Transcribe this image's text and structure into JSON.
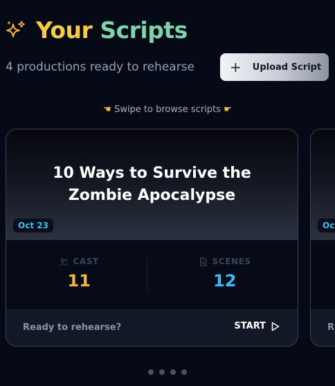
{
  "header": {
    "icon": "sparkles-icon",
    "title_part1": "Your",
    "title_part2": "Scripts",
    "subtitle": "4 productions ready to rehearse",
    "upload_icon": "plus-icon",
    "upload_label": "Upload Script"
  },
  "carousel": {
    "hint": "Swipe to browse scripts",
    "hint_icons": [
      "pointing-hand-left-icon",
      "pointing-hand-right-icon"
    ],
    "cards": [
      {
        "title": "10 Ways to Survive the Zombie Apocalypse",
        "date": "Oct 23",
        "cast_label": "CAST",
        "cast_icon": "users-icon",
        "cast_value": "11",
        "scenes_label": "SCENES",
        "scenes_icon": "document-icon",
        "scenes_value": "12",
        "ready_text": "Ready to rehearse?",
        "start_label": "START",
        "start_icon": "play-icon"
      },
      {
        "date": "Oct",
        "ready_text": "R"
      }
    ],
    "page_count": 4
  },
  "colors": {
    "background": "#060a17",
    "title_yellow": "#f7c948",
    "title_green": "#7fd3a8",
    "cast_accent": "#f5b73b",
    "scenes_accent": "#38bdf8"
  }
}
